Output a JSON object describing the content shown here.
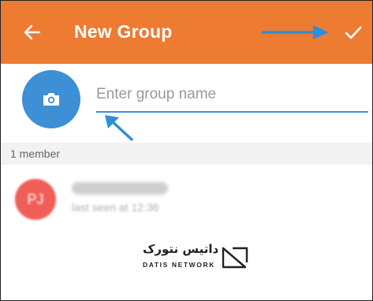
{
  "header": {
    "title": "New Group",
    "background": "#ed7b32",
    "back_icon": "arrow-left-icon",
    "confirm_icon": "checkmark-icon"
  },
  "group": {
    "photo_icon": "camera-icon",
    "photo_color": "#3d8fd6",
    "name_placeholder": "Enter group name",
    "name_value": ""
  },
  "members": {
    "count_label": "1 member",
    "items": [
      {
        "initials": "PJ",
        "avatar_color": "#ef5f57",
        "status": "last seen at 12:36"
      }
    ]
  },
  "annotations": {
    "arrow_color": "#2f8ed8"
  },
  "watermark": {
    "persian": "داتیس نتورک",
    "latin": "DATIS NETWORK"
  }
}
